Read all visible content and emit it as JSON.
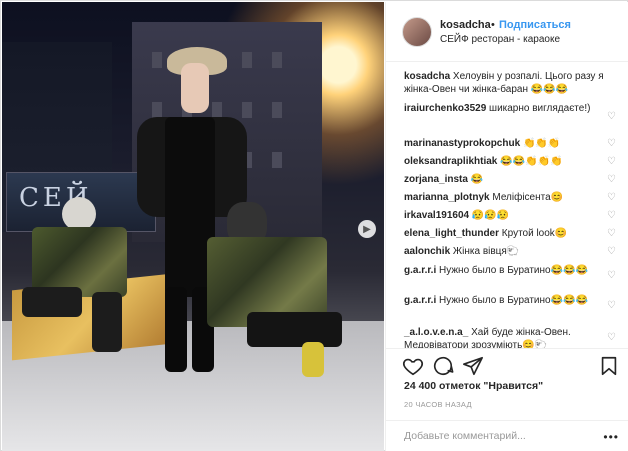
{
  "header": {
    "username": "kosadcha",
    "dot": "•",
    "follow_label": "Подписаться",
    "location": "СЕЙФ ресторан - караоке"
  },
  "photo": {
    "sign_text": "СЕЙ"
  },
  "comments": [
    {
      "user": "kosadcha",
      "text": "Хелоувін у розпалі. Цього разу я жінка-Овен чи жінка-баран 😂😂😂",
      "likeable": false
    },
    {
      "user": "iraiurchenko3529",
      "text": "шикарно виглядаєте!)",
      "likeable": true
    },
    {
      "user": "marinanastyprokopchuk",
      "text": "👏👏👏",
      "likeable": true
    },
    {
      "user": "oleksandraplikhtiak",
      "text": "😂😂👏👏👏",
      "likeable": true
    },
    {
      "user": "zorjana_insta",
      "text": "😂",
      "likeable": true
    },
    {
      "user": "marianna_plotnyk",
      "text": "Меліфісента😊",
      "likeable": true
    },
    {
      "user": "irkaval191604",
      "text": "😥😥😥",
      "likeable": true
    },
    {
      "user": "elena_light_thunder",
      "text": "Крутой look😊",
      "likeable": true
    },
    {
      "user": "aalonchik",
      "text": "Жінка вівця🐑",
      "likeable": true
    },
    {
      "user": "g.a.r.r.i",
      "text": "Нужно было в Буратино😂😂😂",
      "likeable": true
    },
    {
      "user": "g.a.r.r.i",
      "text": "Нужно было в Буратино😂😂😂",
      "likeable": true
    },
    {
      "user": "_a.l.o.v.e.n.a_",
      "text": "Хай буде жінка-Овен. Медовіватори зрозуміють😊🐑",
      "likeable": true
    }
  ],
  "actions": {
    "like_icon": "heart-icon",
    "comment_icon": "comment-bubble-icon",
    "share_icon": "paper-plane-icon",
    "save_icon": "bookmark-icon"
  },
  "likes_text": "24 400 отметок \"Нравится\"",
  "time_text": "20 ЧАСОВ НАЗАД",
  "add_comment": {
    "placeholder": "Добавьте комментарий...",
    "more_label": "•••"
  },
  "colors": {
    "accent": "#3897f0",
    "text": "#262626",
    "muted": "#999999",
    "border": "#efefef"
  }
}
